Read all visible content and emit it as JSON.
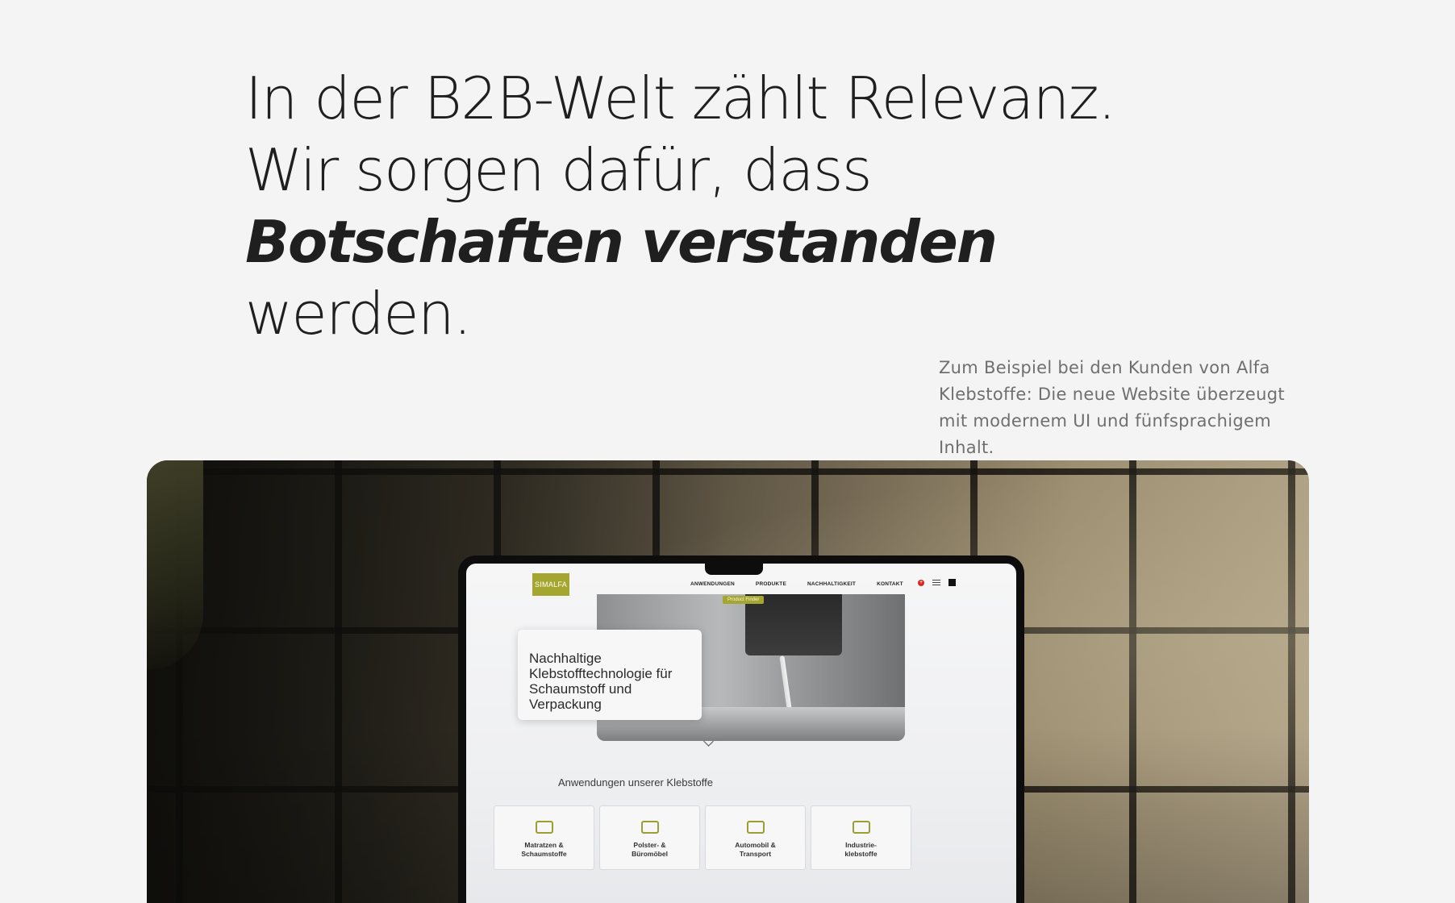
{
  "headline": {
    "part1": "In der B2B-Welt zählt Relevanz. Wir sorgen dafür, dass ",
    "emphasis": "Botschaften verstanden",
    "part2": " werden."
  },
  "caption": "Zum Beispiel bei den Kunden von Alfa Klebstoffe: Die neue Website überzeugt mit modernem UI und fünfsprachigem Inhalt.",
  "showcase": {
    "site": {
      "logo": "SIMALFA",
      "nav": [
        "ANWENDUNGEN",
        "PRODUKTE",
        "NACHHALTIGKEIT",
        "KONTAKT"
      ],
      "product_finder": "Product Finder",
      "hero_text": "Nachhaltige Klebstofftechnologie für Schaumstoff und Verpackung",
      "section_title": "Anwendungen unserer Klebstoffe",
      "applications": [
        {
          "label": "Matratzen &\nSchaumstoffe",
          "icon": "mattress-icon"
        },
        {
          "label": "Polster- &\nBüromöbel",
          "icon": "sofa-icon"
        },
        {
          "label": "Automobil &\nTransport",
          "icon": "car-seat-icon"
        },
        {
          "label": "Industrie-\nklebstoffe",
          "icon": "factory-icon"
        }
      ]
    }
  },
  "colors": {
    "background": "#f4f4f4",
    "text": "#1f1f1f",
    "caption": "#6f6f6f",
    "brand_olive": "#a5a62f"
  }
}
